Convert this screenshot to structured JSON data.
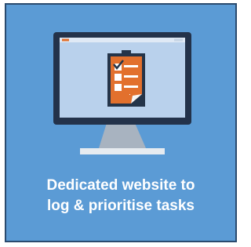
{
  "colors": {
    "card_background": "#5b9bd5",
    "card_border": "#2a4a6e",
    "monitor_frame": "#23324a",
    "screen": "#b9d1ec",
    "clipboard": "#e2702d",
    "stand": "#9aa6b4",
    "caption_text": "#ffffff"
  },
  "caption": {
    "line1": "Dedicated website to",
    "line2": "log & prioritise tasks"
  },
  "icons": [
    "monitor-icon",
    "clipboard-icon",
    "checkbox-icon"
  ]
}
